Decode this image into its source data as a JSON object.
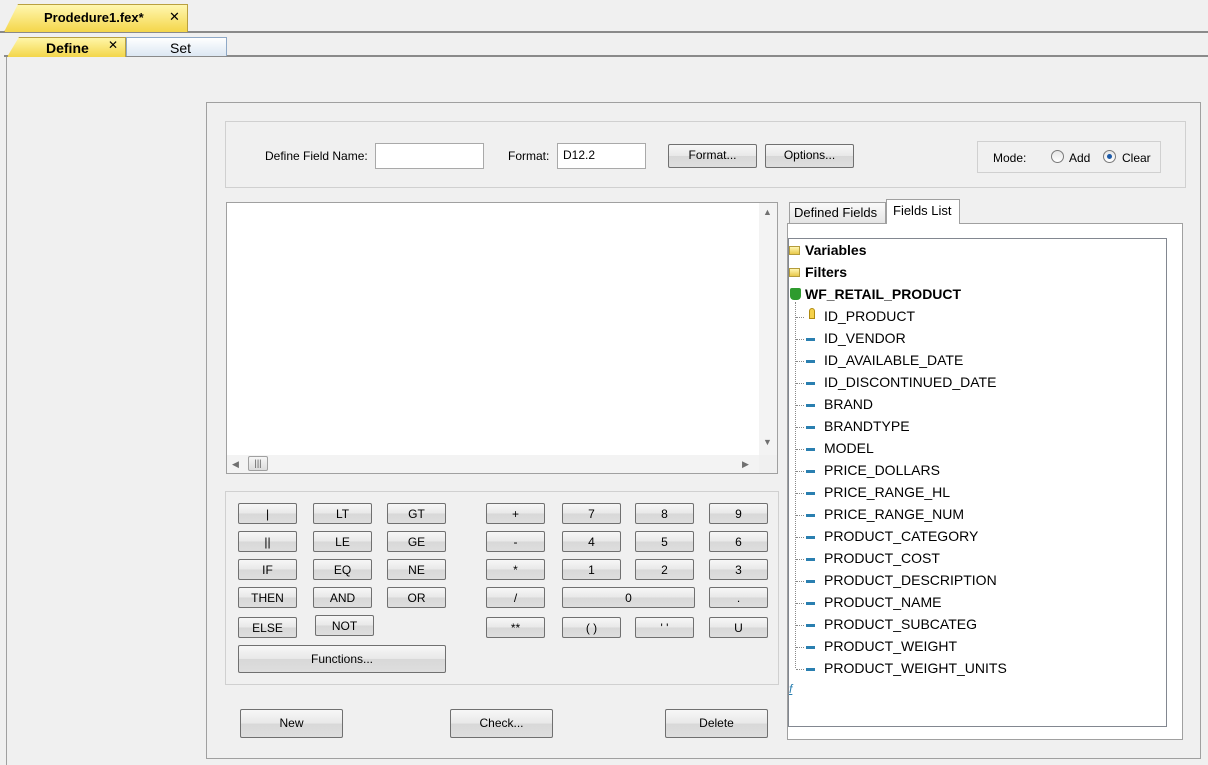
{
  "document_tab": {
    "label": "Prodedure1.fex*",
    "close": "✕"
  },
  "tabs": {
    "define": "Define",
    "define_close": "✕",
    "set": "Set"
  },
  "top": {
    "field_name_label": "Define Field Name:",
    "field_name_value": "",
    "format_label": "Format:",
    "format_value": "D12.2",
    "format_button": "Format...",
    "options_button": "Options...",
    "mode_label": "Mode:",
    "mode_add": "Add",
    "mode_clear": "Clear",
    "mode_selected": "Clear"
  },
  "calculator": {
    "logic": [
      "|",
      "LT",
      "GT",
      "||",
      "LE",
      "GE",
      "IF",
      "EQ",
      "NE",
      "THEN",
      "AND",
      "OR",
      "ELSE",
      "NOT"
    ],
    "ops": [
      "+",
      "-",
      "*",
      "/",
      "**"
    ],
    "digits": [
      "7",
      "8",
      "9",
      "4",
      "5",
      "6",
      "1",
      "2",
      "3",
      "0",
      ".",
      "( )",
      "' '",
      "U"
    ],
    "functions": "Functions..."
  },
  "bottom_buttons": {
    "new": "New",
    "check": "Check...",
    "delete": "Delete"
  },
  "right_tabs": {
    "defined_fields": "Defined Fields",
    "fields_list": "Fields List",
    "active": "Fields List"
  },
  "tree": {
    "groups": [
      "Variables",
      "Filters"
    ],
    "table": "WF_RETAIL_PRODUCT",
    "fields": [
      "ID_PRODUCT",
      "ID_VENDOR",
      "ID_AVAILABLE_DATE",
      "ID_DISCONTINUED_DATE",
      "BRAND",
      "BRANDTYPE",
      "MODEL",
      "PRICE_DOLLARS",
      "PRICE_RANGE_HL",
      "PRICE_RANGE_NUM",
      "PRODUCT_CATEGORY",
      "PRODUCT_COST",
      "PRODUCT_DESCRIPTION",
      "PRODUCT_NAME",
      "PRODUCT_SUBCATEG",
      "PRODUCT_WEIGHT",
      "PRODUCT_WEIGHT_UNITS"
    ],
    "function_glyph": "f"
  },
  "colors": {
    "active_tab": "#f3d64b",
    "radio_selected": "#1c5aa8",
    "db_icon": "#2e9b2e"
  }
}
